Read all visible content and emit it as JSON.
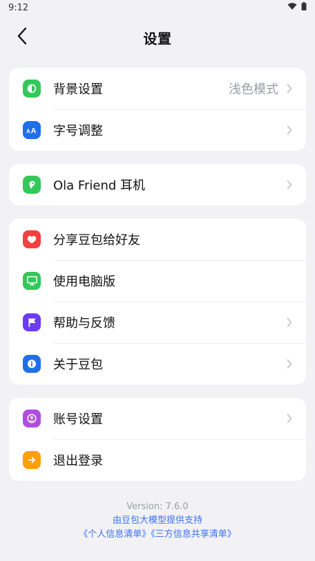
{
  "status_bar": {
    "time": "9:12",
    "icons": [
      "wifi-icon",
      "battery-icon"
    ]
  },
  "header": {
    "title": "设置",
    "back_icon": "back-chevron-icon"
  },
  "sections": [
    {
      "items": [
        {
          "label": "背景设置",
          "value": "浅色模式",
          "icon": "contrast-icon",
          "icon_color": "#34c759",
          "chevron": true
        },
        {
          "label": "字号调整",
          "value": "",
          "icon": "font-size-icon",
          "icon_color": "#1f6feb",
          "chevron": true
        }
      ]
    },
    {
      "items": [
        {
          "label": "Ola Friend 耳机",
          "value": "",
          "icon": "earbud-icon",
          "icon_color": "#34c759",
          "chevron": true
        }
      ]
    },
    {
      "items": [
        {
          "label": "分享豆包给好友",
          "value": "",
          "icon": "heart-icon",
          "icon_color": "#f43f3f",
          "chevron": false
        },
        {
          "label": "使用电脑版",
          "value": "",
          "icon": "monitor-icon",
          "icon_color": "#34c759",
          "chevron": false
        },
        {
          "label": "帮助与反馈",
          "value": "",
          "icon": "flag-icon",
          "icon_color": "#6c3cf5",
          "chevron": true
        },
        {
          "label": "关于豆包",
          "value": "",
          "icon": "info-icon",
          "icon_color": "#1f6feb",
          "chevron": true
        }
      ]
    },
    {
      "items": [
        {
          "label": "账号设置",
          "value": "",
          "icon": "account-icon",
          "icon_color": "#b04de0",
          "chevron": true
        },
        {
          "label": "退出登录",
          "value": "",
          "icon": "logout-icon",
          "icon_color": "#ff9f0a",
          "chevron": false
        }
      ]
    }
  ],
  "footer": {
    "version": "Version: 7.6.0",
    "support_text": "由豆包大模型提供支持",
    "personal_info_link": "《个人信息清单》",
    "third_party_link": "《三方信息共享清单》"
  },
  "colors": {
    "background": "#f2f2f5",
    "card": "#ffffff",
    "link": "#3b6ff5",
    "secondary_text": "#9a9da3"
  }
}
